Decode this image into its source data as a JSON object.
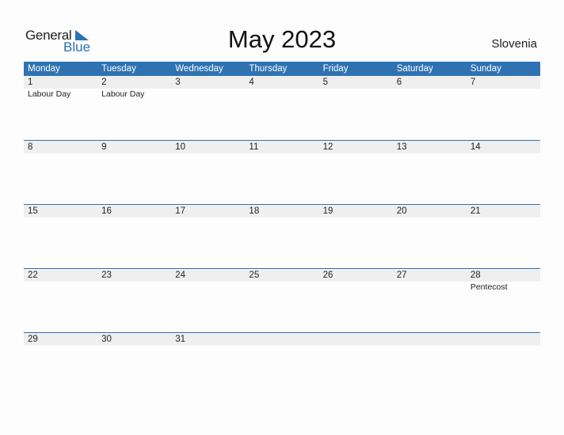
{
  "logo": {
    "general": "General",
    "blue": "Blue",
    "accent_color": "#2a72b5"
  },
  "title": "May 2023",
  "country": "Slovenia",
  "header_color": "#2f72b2",
  "days": [
    "Monday",
    "Tuesday",
    "Wednesday",
    "Thursday",
    "Friday",
    "Saturday",
    "Sunday"
  ],
  "weeks": [
    {
      "dates": [
        "1",
        "2",
        "3",
        "4",
        "5",
        "6",
        "7"
      ],
      "holidays": [
        "Labour Day",
        "Labour Day",
        "",
        "",
        "",
        "",
        ""
      ]
    },
    {
      "dates": [
        "8",
        "9",
        "10",
        "11",
        "12",
        "13",
        "14"
      ],
      "holidays": [
        "",
        "",
        "",
        "",
        "",
        "",
        ""
      ]
    },
    {
      "dates": [
        "15",
        "16",
        "17",
        "18",
        "19",
        "20",
        "21"
      ],
      "holidays": [
        "",
        "",
        "",
        "",
        "",
        "",
        ""
      ]
    },
    {
      "dates": [
        "22",
        "23",
        "24",
        "25",
        "26",
        "27",
        "28"
      ],
      "holidays": [
        "",
        "",
        "",
        "",
        "",
        "",
        "Pentecost"
      ]
    },
    {
      "dates": [
        "29",
        "30",
        "31",
        "",
        "",
        "",
        ""
      ],
      "holidays": [
        "",
        "",
        "",
        "",
        "",
        "",
        ""
      ]
    }
  ]
}
